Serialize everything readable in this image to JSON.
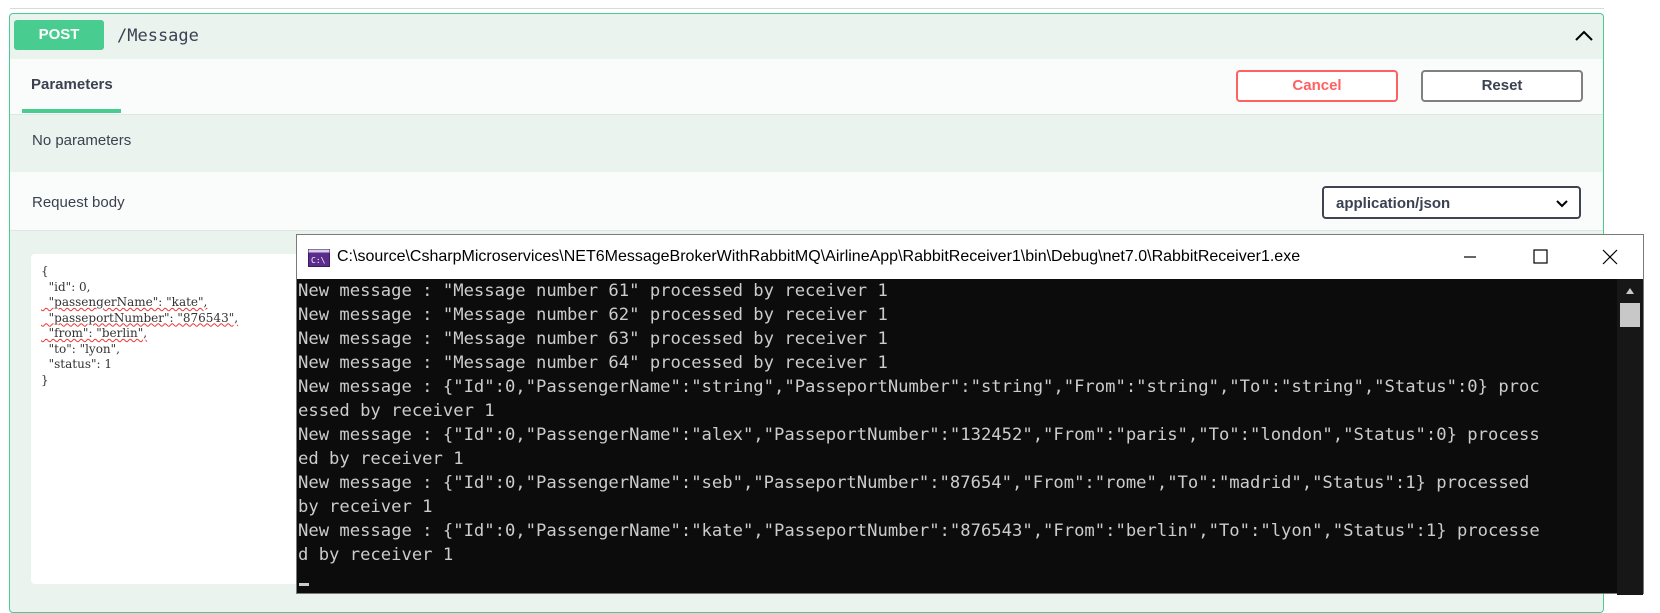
{
  "operation": {
    "method": "POST",
    "path": "/Message"
  },
  "tabs": {
    "parameters": "Parameters"
  },
  "buttons": {
    "cancel": "Cancel",
    "reset": "Reset"
  },
  "parameters_text": "No parameters",
  "request_body": {
    "label": "Request body",
    "content_type": "application/json",
    "code_lines": [
      "{",
      "  \"id\": 0,",
      "  \"passengerName\": \"kate\",",
      "  \"passeportNumber\": \"876543\",",
      "  \"from\": \"berlin\",",
      "  \"to\": \"lyon\",",
      "  \"status\": 1",
      "}"
    ]
  },
  "console": {
    "title": "C:\\source\\CsharpMicroservices\\NET6MessageBrokerWithRabbitMQ\\AirlineApp\\RabbitReceiver1\\bin\\Debug\\net7.0\\RabbitReceiver1.exe",
    "lines": [
      "New message : \"Message number 61\" processed by receiver 1",
      "New message : \"Message number 62\" processed by receiver 1",
      "New message : \"Message number 63\" processed by receiver 1",
      "New message : \"Message number 64\" processed by receiver 1",
      "New message : {\"Id\":0,\"PassengerName\":\"string\",\"PasseportNumber\":\"string\",\"From\":\"string\",\"To\":\"string\",\"Status\":0} proc",
      "essed by receiver 1",
      "New message : {\"Id\":0,\"PassengerName\":\"alex\",\"PasseportNumber\":\"132452\",\"From\":\"paris\",\"To\":\"london\",\"Status\":0} process",
      "ed by receiver 1",
      "New message : {\"Id\":0,\"PassengerName\":\"seb\",\"PasseportNumber\":\"87654\",\"From\":\"rome\",\"To\":\"madrid\",\"Status\":1} processed",
      "by receiver 1",
      "New message : {\"Id\":0,\"PassengerName\":\"kate\",\"PasseportNumber\":\"876543\",\"From\":\"berlin\",\"To\":\"lyon\",\"Status\":1} processe",
      "d by receiver 1"
    ]
  },
  "colors": {
    "post_green": "#49cc90",
    "cancel_red": "#ff6060",
    "console_bg": "#0c0c0c",
    "console_text": "#cccccc"
  },
  "icons": {
    "collapse": "chevron-up-icon",
    "dropdown": "chevron-down-icon",
    "console": "console-app-icon",
    "minimize": "minimize-icon",
    "maximize": "maximize-icon",
    "close": "close-icon"
  }
}
